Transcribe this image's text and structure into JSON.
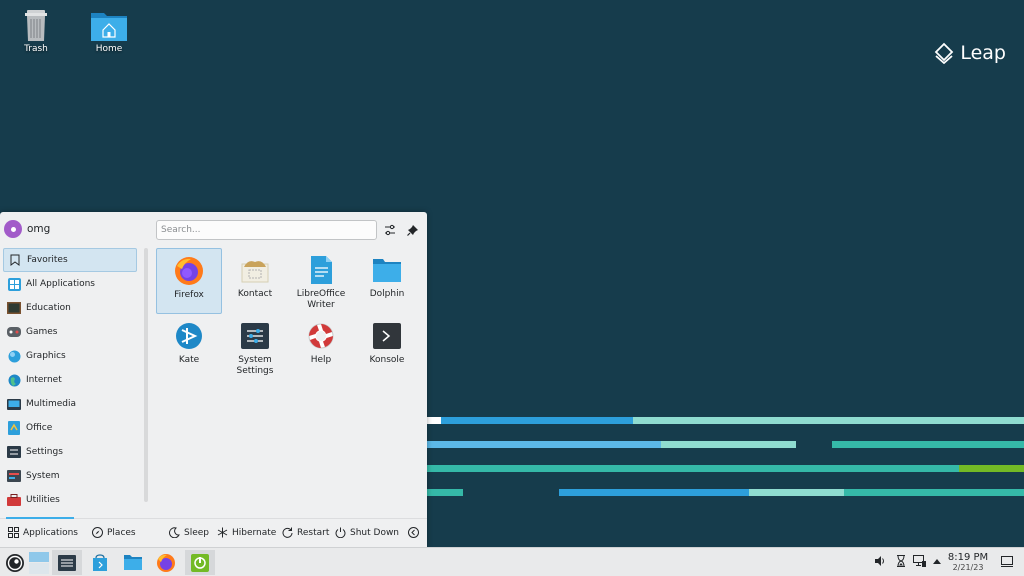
{
  "desktop": {
    "icons": [
      {
        "label": "Trash",
        "icon": "trash-icon"
      },
      {
        "label": "Home",
        "icon": "home-folder-icon"
      }
    ],
    "logo_text": "Leap"
  },
  "launcher": {
    "user": "omg",
    "search_placeholder": "Search...",
    "categories": [
      {
        "label": "Favorites",
        "icon": "bookmark-icon"
      },
      {
        "label": "All Applications",
        "icon": "grid-icon"
      },
      {
        "label": "Education",
        "icon": "chalkboard-icon"
      },
      {
        "label": "Games",
        "icon": "gamepad-icon"
      },
      {
        "label": "Graphics",
        "icon": "graphics-icon"
      },
      {
        "label": "Internet",
        "icon": "globe-icon"
      },
      {
        "label": "Multimedia",
        "icon": "multimedia-icon"
      },
      {
        "label": "Office",
        "icon": "office-icon"
      },
      {
        "label": "Settings",
        "icon": "settings-icon"
      },
      {
        "label": "System",
        "icon": "system-icon"
      },
      {
        "label": "Utilities",
        "icon": "toolbox-icon"
      }
    ],
    "selected_category": "Favorites",
    "apps": [
      {
        "label": "Firefox",
        "icon": "firefox-icon"
      },
      {
        "label": "Kontact",
        "icon": "kontact-icon"
      },
      {
        "label": "LibreOffice Writer",
        "icon": "writer-icon"
      },
      {
        "label": "Dolphin",
        "icon": "dolphin-folder-icon"
      },
      {
        "label": "Kate",
        "icon": "kate-icon"
      },
      {
        "label": "System Settings",
        "icon": "system-settings-icon"
      },
      {
        "label": "Help",
        "icon": "lifebuoy-icon"
      },
      {
        "label": "Konsole",
        "icon": "terminal-icon"
      }
    ],
    "footer": {
      "applications": "Applications",
      "places": "Places",
      "sleep": "Sleep",
      "hibernate": "Hibernate",
      "restart": "Restart",
      "shutdown": "Shut Down"
    }
  },
  "taskbar": {
    "time": "8:19 PM",
    "date": "2/21/23"
  },
  "colors": {
    "wallpaper": "#163c4c",
    "accent": "#3daee9",
    "stripe_teal": "#35b9a8",
    "stripe_blue": "#2d9fdb",
    "stripe_light": "#8fdcd0",
    "stripe_green": "#73ba25"
  }
}
